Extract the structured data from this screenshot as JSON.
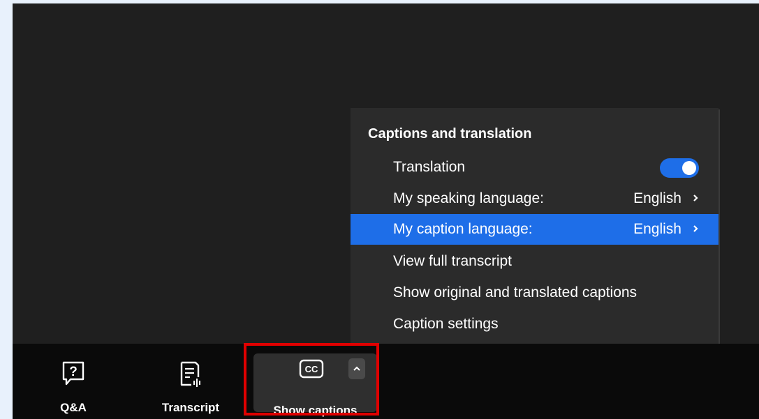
{
  "toolbar": {
    "qa_label": "Q&A",
    "transcript_label": "Transcript",
    "captions_label": "Show captions",
    "cc_text": "CC"
  },
  "menu": {
    "title": "Captions and translation",
    "items": [
      {
        "label": "Translation",
        "toggle_on": true
      },
      {
        "label": "My speaking language:",
        "value": "English"
      },
      {
        "label": "My caption language:",
        "value": "English",
        "highlighted": true
      },
      {
        "label": "View full transcript"
      },
      {
        "label": "Show original and translated captions"
      },
      {
        "label": "Caption settings"
      }
    ]
  },
  "colors": {
    "accent": "#1e6ee8",
    "highlight_border": "#e00000",
    "panel_bg": "#2b2b2b",
    "app_bg": "#1f1f1f",
    "toolbar_bg": "#0a0a0a"
  }
}
